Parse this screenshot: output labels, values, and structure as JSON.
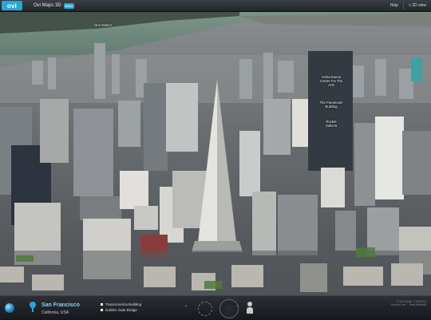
{
  "header": {
    "logo": "ovi",
    "app_name": "Ovi Maps 3D",
    "beta_badge": "Beta",
    "help": "Help",
    "view_2d": "< 2D view"
  },
  "map": {
    "labels": {
      "one_market": "One Market",
      "tower_1": "Verba Buena\nCenter For The\nArts",
      "tower_2": "The Paramount\nBuilding",
      "tower_3": "Rocket\nGalleria"
    }
  },
  "footer": {
    "location_city": "San Francisco",
    "location_region": "California, USA",
    "landmarks": [
      {
        "label": "TransAmerica Building"
      },
      {
        "label": "Golden Gate Bridge"
      }
    ],
    "copyright": "© 2010 Nokia  © NAVTEQ\nTerms of use  ·  Send feedback"
  },
  "colors": {
    "accent": "#27a6d8",
    "water": "#6f8a79",
    "city_dark": "#3c4148"
  }
}
